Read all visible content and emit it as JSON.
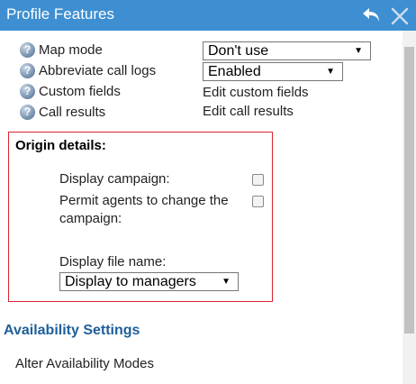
{
  "window": {
    "title": "Profile Features",
    "undo_icon": "undo-icon",
    "close_icon": "close-icon"
  },
  "colors": {
    "titlebar": "#3d8fd1",
    "highlight_border": "#d9242f",
    "section_heading": "#1f5f99"
  },
  "settings": [
    {
      "label": "Map mode",
      "control": "select",
      "value": "Don't use"
    },
    {
      "label": "Abbreviate call logs",
      "control": "select",
      "value": "Enabled"
    },
    {
      "label": "Custom fields",
      "control": "link",
      "value": "Edit custom fields"
    },
    {
      "label": "Call results",
      "control": "link",
      "value": "Edit call results"
    }
  ],
  "origin_details": {
    "title": "Origin details:",
    "display_campaign": {
      "label": "Display campaign:",
      "checked": false
    },
    "permit_change": {
      "label_line1": "Permit agents to change the",
      "label_line2": "campaign:",
      "checked": false
    },
    "display_file_name": {
      "label": "Display file name:",
      "value": "Display to managers"
    }
  },
  "availability": {
    "heading": "Availability Settings",
    "alter_modes": "Alter Availability Modes"
  }
}
